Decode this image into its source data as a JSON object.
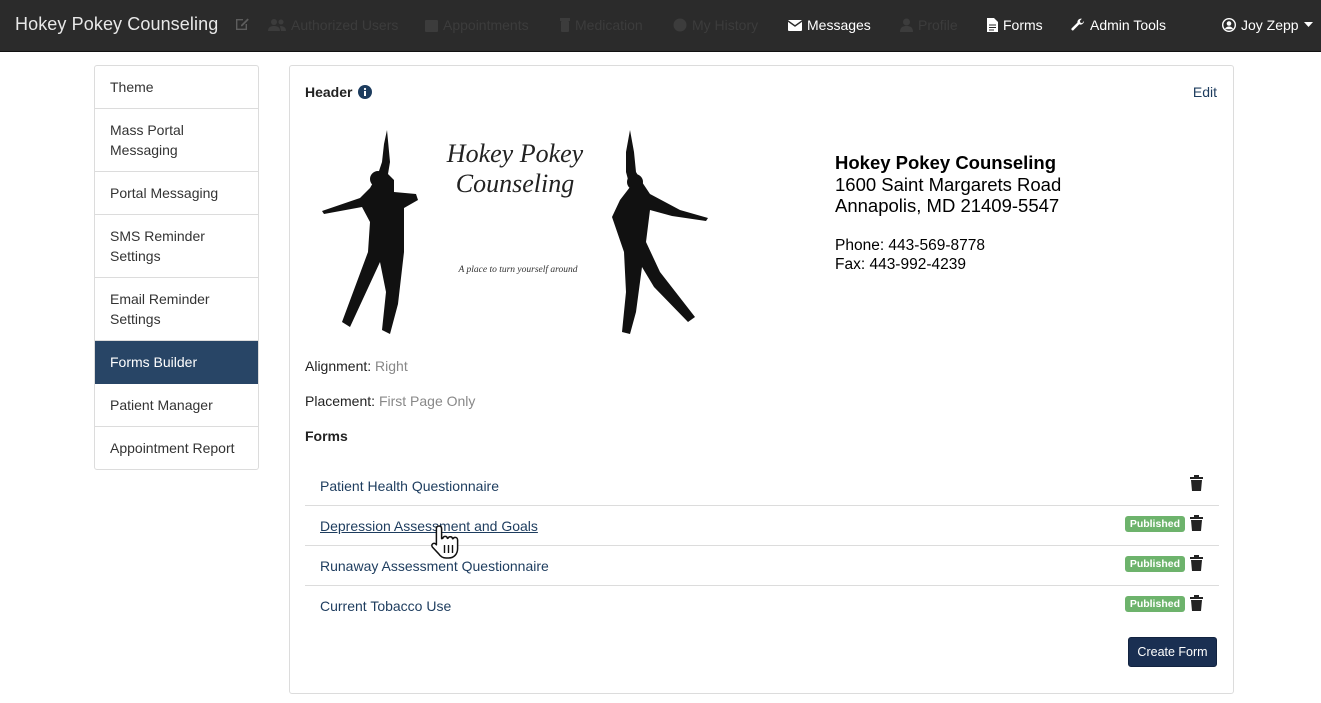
{
  "navbar": {
    "brand": "Hokey Pokey Counseling",
    "items": [
      {
        "label": "Authorized Users",
        "icon": "users-icon",
        "dim": true
      },
      {
        "label": "Appointments",
        "icon": "calendar-icon",
        "dim": true
      },
      {
        "label": "Medication",
        "icon": "medication-icon",
        "dim": true
      },
      {
        "label": "My History",
        "icon": "history-icon",
        "dim": true
      },
      {
        "label": "Messages",
        "icon": "envelope-icon",
        "dim": false
      },
      {
        "label": "Profile",
        "icon": "user-icon",
        "dim": true
      },
      {
        "label": "Forms",
        "icon": "document-icon",
        "dim": false
      },
      {
        "label": "Admin Tools",
        "icon": "wrench-icon",
        "dim": false
      }
    ],
    "user": "Joy Zepp"
  },
  "sidebar": {
    "items": [
      {
        "label": "Theme",
        "active": false
      },
      {
        "label": "Mass Portal Messaging",
        "active": false
      },
      {
        "label": "Portal Messaging",
        "active": false
      },
      {
        "label": "SMS Reminder Settings",
        "active": false
      },
      {
        "label": "Email Reminder Settings",
        "active": false
      },
      {
        "label": "Forms Builder",
        "active": true
      },
      {
        "label": "Patient Manager",
        "active": false
      },
      {
        "label": "Appointment Report",
        "active": false
      }
    ]
  },
  "panel": {
    "title": "Header",
    "edit_label": "Edit",
    "logo": {
      "line1": "Hokey Pokey",
      "line2": "Counseling",
      "tagline": "A place to turn yourself around"
    },
    "address": {
      "name": "Hokey Pokey Counseling",
      "street": "1600 Saint Margarets Road",
      "city": "Annapolis, MD 21409-5547",
      "phone": "Phone: 443-569-8778",
      "fax": "Fax: 443-992-4239"
    },
    "alignment_label": "Alignment:",
    "alignment_value": "Right",
    "placement_label": "Placement:",
    "placement_value": "First Page Only",
    "forms_heading": "Forms",
    "forms": [
      {
        "name": "Patient Health Questionnaire",
        "status": ""
      },
      {
        "name": "Depression Assessment and Goals",
        "status": "Published"
      },
      {
        "name": "Runaway Assessment Questionnaire",
        "status": "Published"
      },
      {
        "name": "Current Tobacco Use",
        "status": "Published"
      }
    ],
    "create_button": "Create Form"
  },
  "colors": {
    "navbar_bg": "#2b2b2b",
    "sidebar_active": "#284566",
    "link": "#1d3c5e",
    "badge": "#6db36c",
    "button": "#1a2f52"
  }
}
